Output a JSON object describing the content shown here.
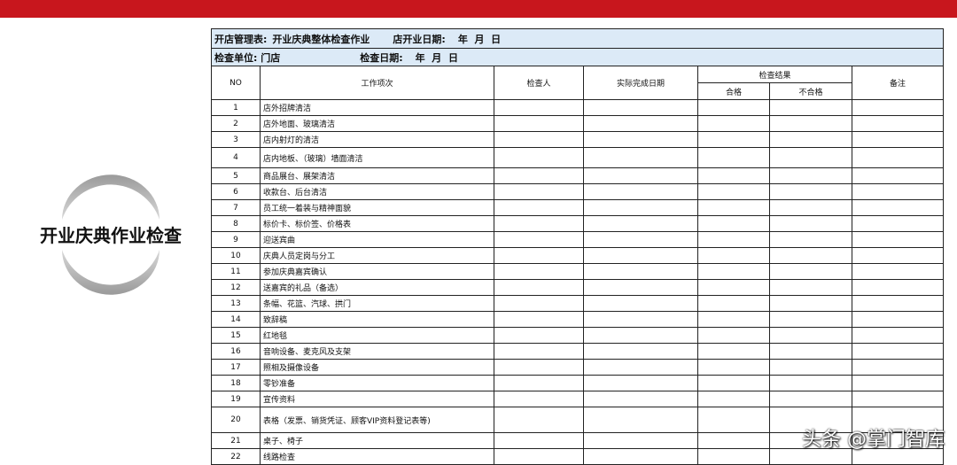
{
  "emblem_title": "开业庆典作业检查",
  "header": {
    "line1_a": "开店管理表:",
    "line1_b": "开业庆典整体检查作业",
    "line1_c": "店开业日期:",
    "line1_d": "年  月  日",
    "line2_a": "检查单位: 门店",
    "line2_b": "检查日期:",
    "line2_c": "年  月  日"
  },
  "columns": {
    "no": "NO",
    "item": "工作项次",
    "inspector": "检查人",
    "actual_date": "实际完成日期",
    "result": "检查结果",
    "pass": "合格",
    "fail": "不合格",
    "remarks": "备注"
  },
  "rows": [
    {
      "no": "1",
      "item": "店外招牌清洁"
    },
    {
      "no": "2",
      "item": "店外地面、玻璃清洁"
    },
    {
      "no": "3",
      "item": "店内射灯的清洁"
    },
    {
      "no": "4",
      "item": "店内地板、（玻璃）墙面清洁"
    },
    {
      "no": "5",
      "item": "商品展台、展架清洁"
    },
    {
      "no": "6",
      "item": "收款台、后台清洁"
    },
    {
      "no": "7",
      "item": "员工统一着装与精神面貌"
    },
    {
      "no": "8",
      "item": "标价卡、标价签、价格表"
    },
    {
      "no": "9",
      "item": "迎送宾曲"
    },
    {
      "no": "10",
      "item": "庆典人员定岗与分工"
    },
    {
      "no": "11",
      "item": "参加庆典嘉宾确认"
    },
    {
      "no": "12",
      "item": "送嘉宾的礼品（备选）"
    },
    {
      "no": "13",
      "item": "条幅、花篮、汽球、拱门"
    },
    {
      "no": "14",
      "item": "致辞稿"
    },
    {
      "no": "15",
      "item": "红地毯"
    },
    {
      "no": "16",
      "item": "音响设备、麦克风及支架"
    },
    {
      "no": "17",
      "item": "照相及摄像设备"
    },
    {
      "no": "18",
      "item": "零钞准备"
    },
    {
      "no": "19",
      "item": "宣传资料"
    },
    {
      "no": "20",
      "item": "表格（发票、销货凭证、顾客VIP资料登记表等)"
    },
    {
      "no": "21",
      "item": "桌子、椅子"
    },
    {
      "no": "22",
      "item": "线路检查"
    }
  ],
  "watermark": "头条 @掌门智库",
  "colors": {
    "topbar": "#c8161d",
    "header_bg": "#dceaf7"
  }
}
